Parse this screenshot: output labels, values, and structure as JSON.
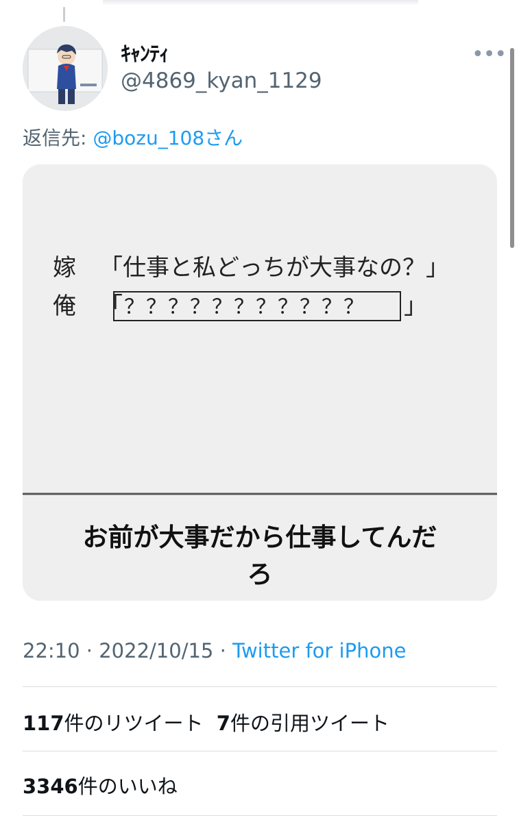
{
  "author": {
    "display_name": "ｷｬﾝﾃｨ",
    "handle": "@4869_kyan_1129",
    "avatar_icon": "avatar-cartoon-boy"
  },
  "more_icon": "more-dots-icon",
  "reply": {
    "prefix": "返信先: ",
    "mention": "@bozu_108さん"
  },
  "media": {
    "line1_speaker": "嫁",
    "line1_text": "「仕事と私どっちが大事なの？」",
    "line2_speaker": "俺",
    "line2_open": "「",
    "line2_box": "？？？？？？？？？？？",
    "line2_close": "」",
    "caption_line1": "お前が大事だから仕事してんだ",
    "caption_line2": "ろ"
  },
  "meta": {
    "time": "22:10",
    "sep1": " · ",
    "date": "2022/10/15",
    "sep2": " · ",
    "source": "Twitter for iPhone"
  },
  "stats": {
    "retweet_count": "117",
    "retweet_label": "件のリツイート",
    "quote_count": "7",
    "quote_label": "件の引用ツイート",
    "like_count": "3346",
    "like_label": "件のいいね"
  },
  "colors": {
    "link": "#1d9bf0",
    "secondary_text": "#536471",
    "media_bg": "#efefef"
  }
}
